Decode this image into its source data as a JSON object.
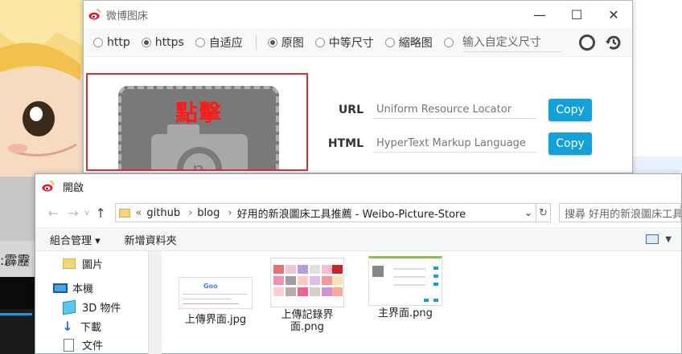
{
  "main_window": {
    "title": "微博图床",
    "window_buttons": {
      "minimize": "—",
      "maximize": "☐",
      "close": "✕"
    },
    "protocol_options": [
      {
        "label": "http",
        "selected": false
      },
      {
        "label": "https",
        "selected": true
      },
      {
        "label": "自适应",
        "selected": false
      }
    ],
    "size_options": [
      {
        "label": "原图",
        "selected": true
      },
      {
        "label": "中等尺寸",
        "selected": false
      },
      {
        "label": "縮略图",
        "selected": false
      },
      {
        "label": "输入自定义尺寸",
        "selected": false
      }
    ],
    "upload": {
      "text": "點擊"
    },
    "fields": [
      {
        "label": "URL",
        "placeholder": "Uniform Resource Locator",
        "button": "Copy"
      },
      {
        "label": "HTML",
        "placeholder": "HyperText Markup Language",
        "button": "Copy"
      }
    ],
    "accent_color": "#14a0d8"
  },
  "open_dialog": {
    "title": "開啟",
    "breadcrumb": {
      "prefix": "«",
      "items": [
        "github",
        "blog",
        "好用的新浪圖床工具推薦 - Weibo-Picture-Store"
      ]
    },
    "search_placeholder": "搜尋 好用的新浪圖床工具",
    "commands": {
      "organize": "組合管理 ▾",
      "new_folder": "新增資料夾"
    },
    "nav": [
      {
        "label": "圖片",
        "icon": "folder-icon"
      },
      {
        "label": "本機",
        "icon": "computer-icon"
      },
      {
        "label": "3D 物件",
        "icon": "3d-objects-icon"
      },
      {
        "label": "下載",
        "icon": "download-icon"
      },
      {
        "label": "文件",
        "icon": "document-icon"
      }
    ],
    "files": [
      {
        "name": "上傳界面.jpg"
      },
      {
        "name": "上傳記錄界面.png"
      },
      {
        "name": "主界面.png"
      }
    ]
  }
}
